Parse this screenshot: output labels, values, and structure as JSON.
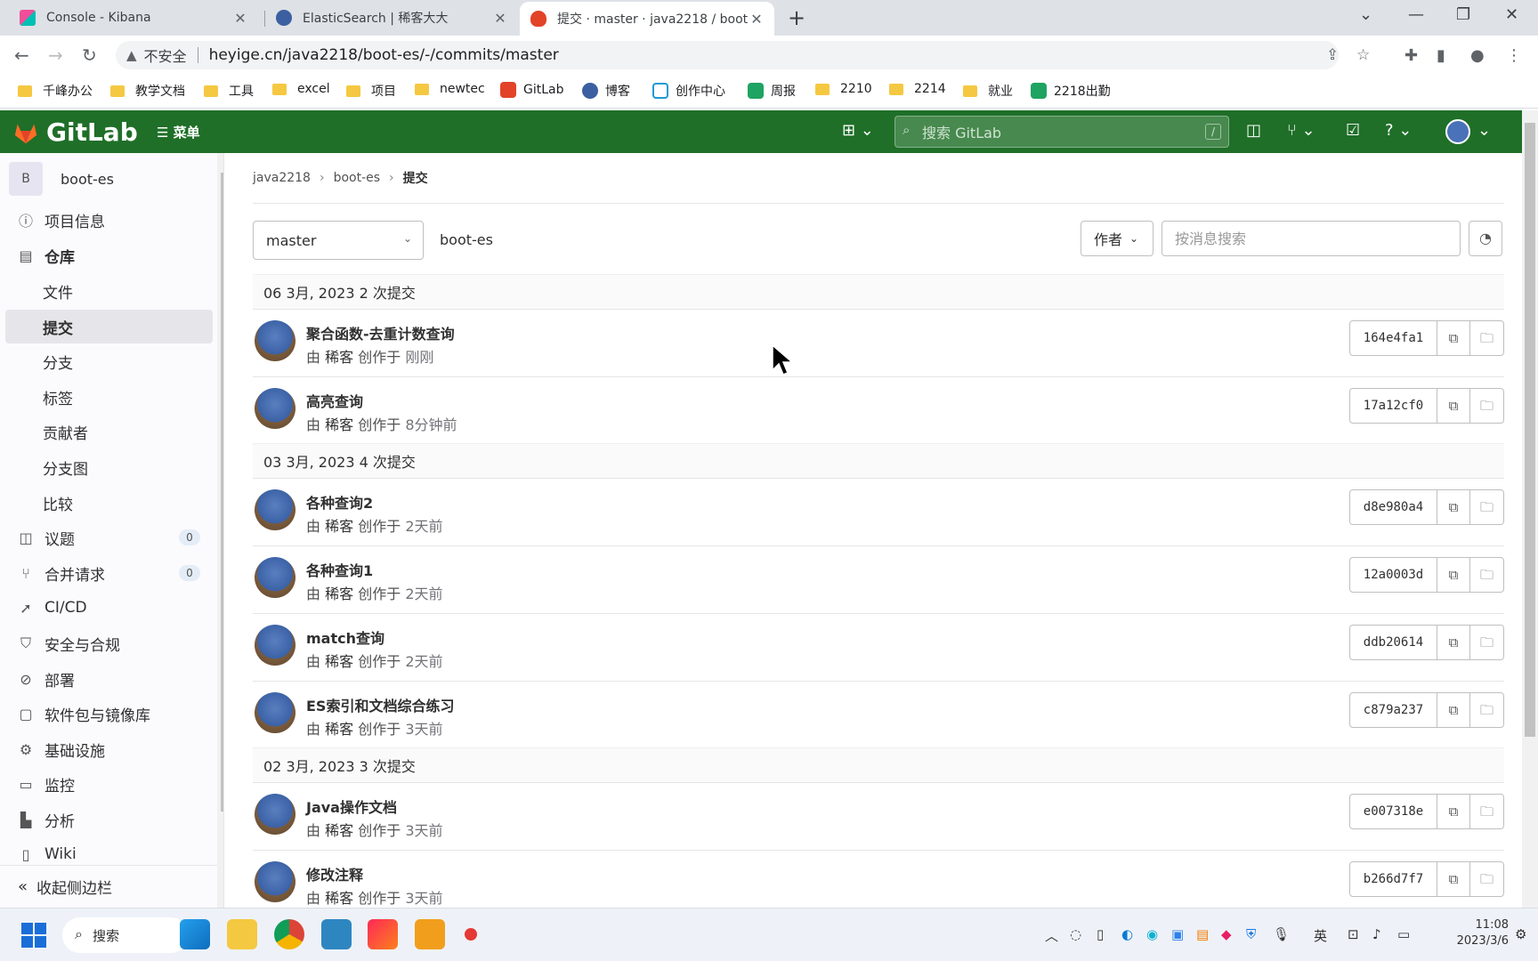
{
  "browser": {
    "tabs": [
      {
        "title": "Console - Kibana",
        "icon": "kibana-icon"
      },
      {
        "title": "ElasticSearch | 稀客大大",
        "icon": "blog-avatar-icon"
      },
      {
        "title": "提交 · master · java2218 / boot",
        "icon": "gitlab-icon"
      }
    ],
    "security_label": "不安全",
    "url": "heyige.cn/java2218/boot-es/-/commits/master",
    "bookmarks": [
      "千峰办公",
      "教学文档",
      "工具",
      "excel",
      "项目",
      "newtec",
      "GitLab",
      "博客",
      "创作中心",
      "周报",
      "2210",
      "2214",
      "就业",
      "2218出勤"
    ]
  },
  "gitlab": {
    "logo_text": "GitLab",
    "menu_label": "菜单",
    "search_placeholder": "搜索 GitLab",
    "search_shortcut": "/"
  },
  "sidebar": {
    "project_initial": "B",
    "project_name": "boot-es",
    "items": [
      {
        "label": "项目信息",
        "icon": "info-icon"
      },
      {
        "label": "仓库",
        "icon": "document-icon"
      },
      {
        "label": "文件"
      },
      {
        "label": "提交"
      },
      {
        "label": "分支"
      },
      {
        "label": "标签"
      },
      {
        "label": "贡献者"
      },
      {
        "label": "分支图"
      },
      {
        "label": "比较"
      },
      {
        "label": "议题",
        "icon": "issues-icon",
        "count": "0"
      },
      {
        "label": "合并请求",
        "icon": "merge-request-icon",
        "count": "0"
      },
      {
        "label": "CI/CD",
        "icon": "rocket-icon"
      },
      {
        "label": "安全与合规",
        "icon": "shield-icon"
      },
      {
        "label": "部署",
        "icon": "deploy-icon"
      },
      {
        "label": "软件包与镜像库",
        "icon": "package-icon"
      },
      {
        "label": "基础设施",
        "icon": "cloud-gear-icon"
      },
      {
        "label": "监控",
        "icon": "monitor-icon"
      },
      {
        "label": "分析",
        "icon": "chart-icon"
      },
      {
        "label": "Wiki",
        "icon": "book-icon"
      }
    ],
    "collapse_label": "收起侧边栏"
  },
  "main": {
    "breadcrumbs": [
      "java2218",
      "boot-es",
      "提交"
    ],
    "branch": "master",
    "path": "boot-es",
    "author_label": "作者",
    "search_placeholder": "按消息搜索",
    "groups": [
      {
        "date": "06 3月, 2023 2 次提交",
        "commits": [
          {
            "title": "聚合函数-去重计数查询",
            "by": "由",
            "author": "稀客",
            "created": "创作于",
            "time": "刚刚",
            "sha": "164e4fa1"
          },
          {
            "title": "高亮查询",
            "by": "由",
            "author": "稀客",
            "created": "创作于",
            "time": "8分钟前",
            "sha": "17a12cf0"
          }
        ]
      },
      {
        "date": "03 3月, 2023 4 次提交",
        "commits": [
          {
            "title": "各种查询2",
            "by": "由",
            "author": "稀客",
            "created": "创作于",
            "time": "2天前",
            "sha": "d8e980a4"
          },
          {
            "title": "各种查询1",
            "by": "由",
            "author": "稀客",
            "created": "创作于",
            "time": "2天前",
            "sha": "12a0003d"
          },
          {
            "title": "match查询",
            "by": "由",
            "author": "稀客",
            "created": "创作于",
            "time": "2天前",
            "sha": "ddb20614"
          },
          {
            "title": "ES索引和文档综合练习",
            "by": "由",
            "author": "稀客",
            "created": "创作于",
            "time": "3天前",
            "sha": "c879a237"
          }
        ]
      },
      {
        "date": "02 3月, 2023 3 次提交",
        "commits": [
          {
            "title": "Java操作文档",
            "by": "由",
            "author": "稀客",
            "created": "创作于",
            "time": "3天前",
            "sha": "e007318e"
          },
          {
            "title": "修改注释",
            "by": "由",
            "author": "稀客",
            "created": "创作于",
            "time": "3天前",
            "sha": "b266d7f7"
          }
        ]
      }
    ]
  },
  "taskbar": {
    "search_label": "搜索",
    "ime": "英",
    "time": "11:08",
    "date": "2023/3/6"
  },
  "colors": {
    "gitlab_header": "#1f6f28",
    "tab_bar": "#dee1e6"
  }
}
